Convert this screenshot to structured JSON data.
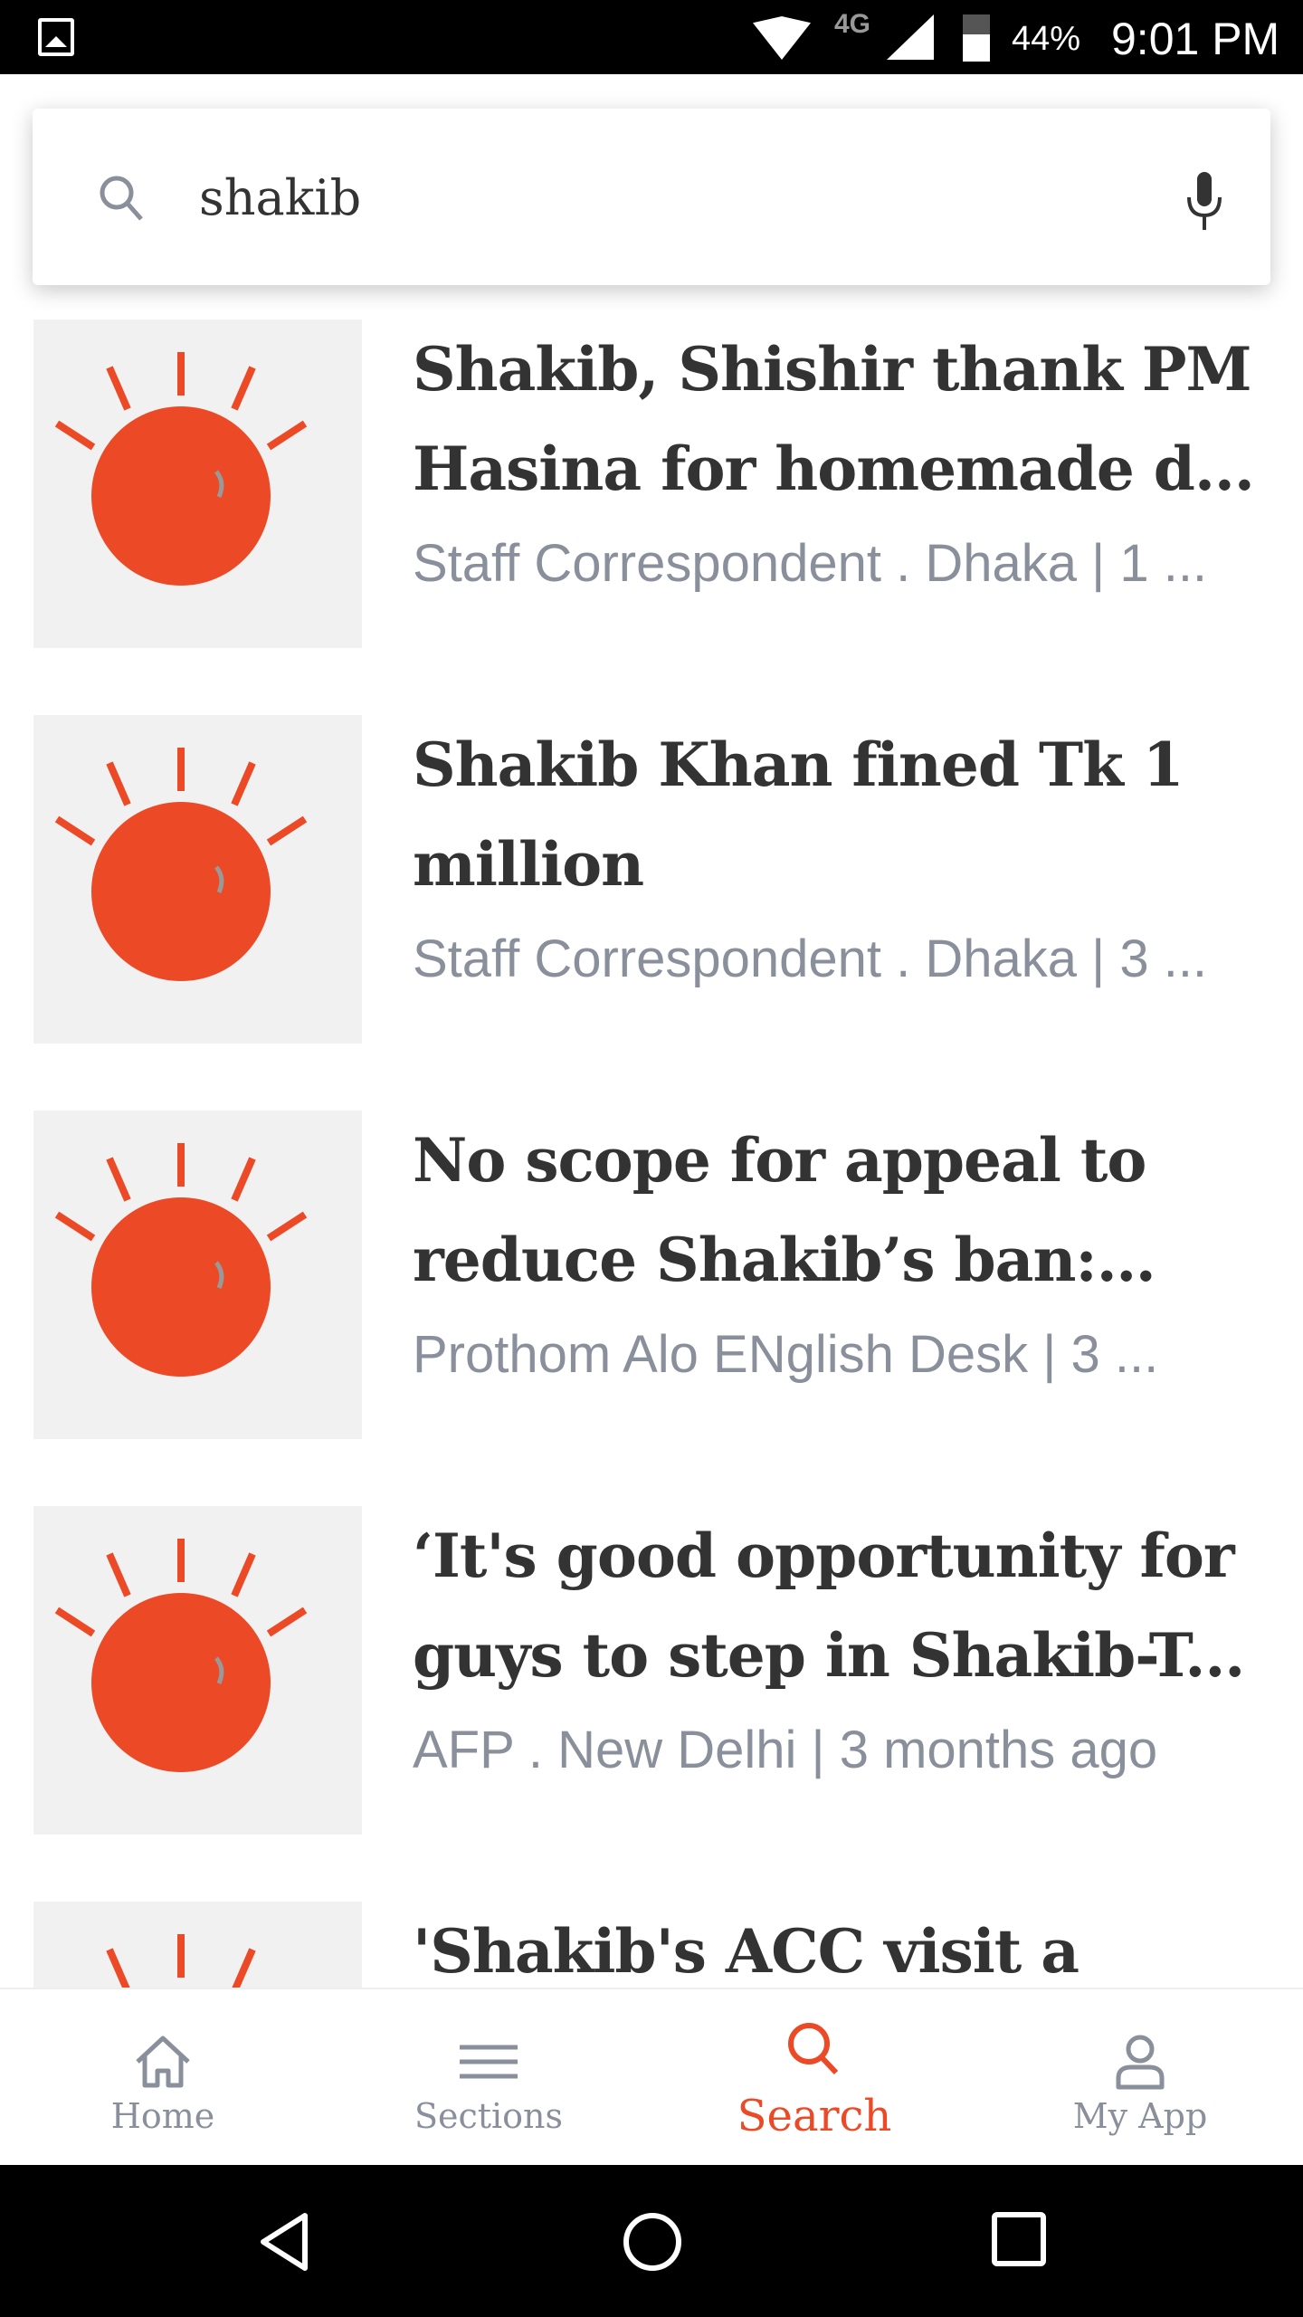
{
  "status_bar": {
    "network": "4G",
    "battery": "44%",
    "time": "9:01 PM"
  },
  "search": {
    "query": "shakib",
    "placeholder": ""
  },
  "results": [
    {
      "title": "Shakib, Shishir thank PM Hasina for homemade d...",
      "meta": "Staff Correspondent . Dhaka | 1 ..."
    },
    {
      "title": "Shakib Khan fined Tk 1 million",
      "meta": "Staff Correspondent . Dhaka | 3 ..."
    },
    {
      "title": "No scope for appeal to reduce Shakib’s ban: BC...",
      "meta": "Prothom Alo ENglish Desk | 3  ..."
    },
    {
      "title": "‘It's good opportunity for guys to step in Shakib-T...",
      "meta": "AFP . New Delhi | 3  months ago"
    },
    {
      "title": "'Shakib's ACC visit a",
      "meta": ""
    }
  ],
  "bottom_nav": [
    {
      "label": "Home",
      "icon": "home-icon"
    },
    {
      "label": "Sections",
      "icon": "menu-icon"
    },
    {
      "label": "Search",
      "icon": "search-icon",
      "active": true
    },
    {
      "label": "My App",
      "icon": "user-icon"
    }
  ],
  "colors": {
    "accent": "#ec4a26",
    "muted": "#8a8f9c",
    "text": "#333333"
  }
}
